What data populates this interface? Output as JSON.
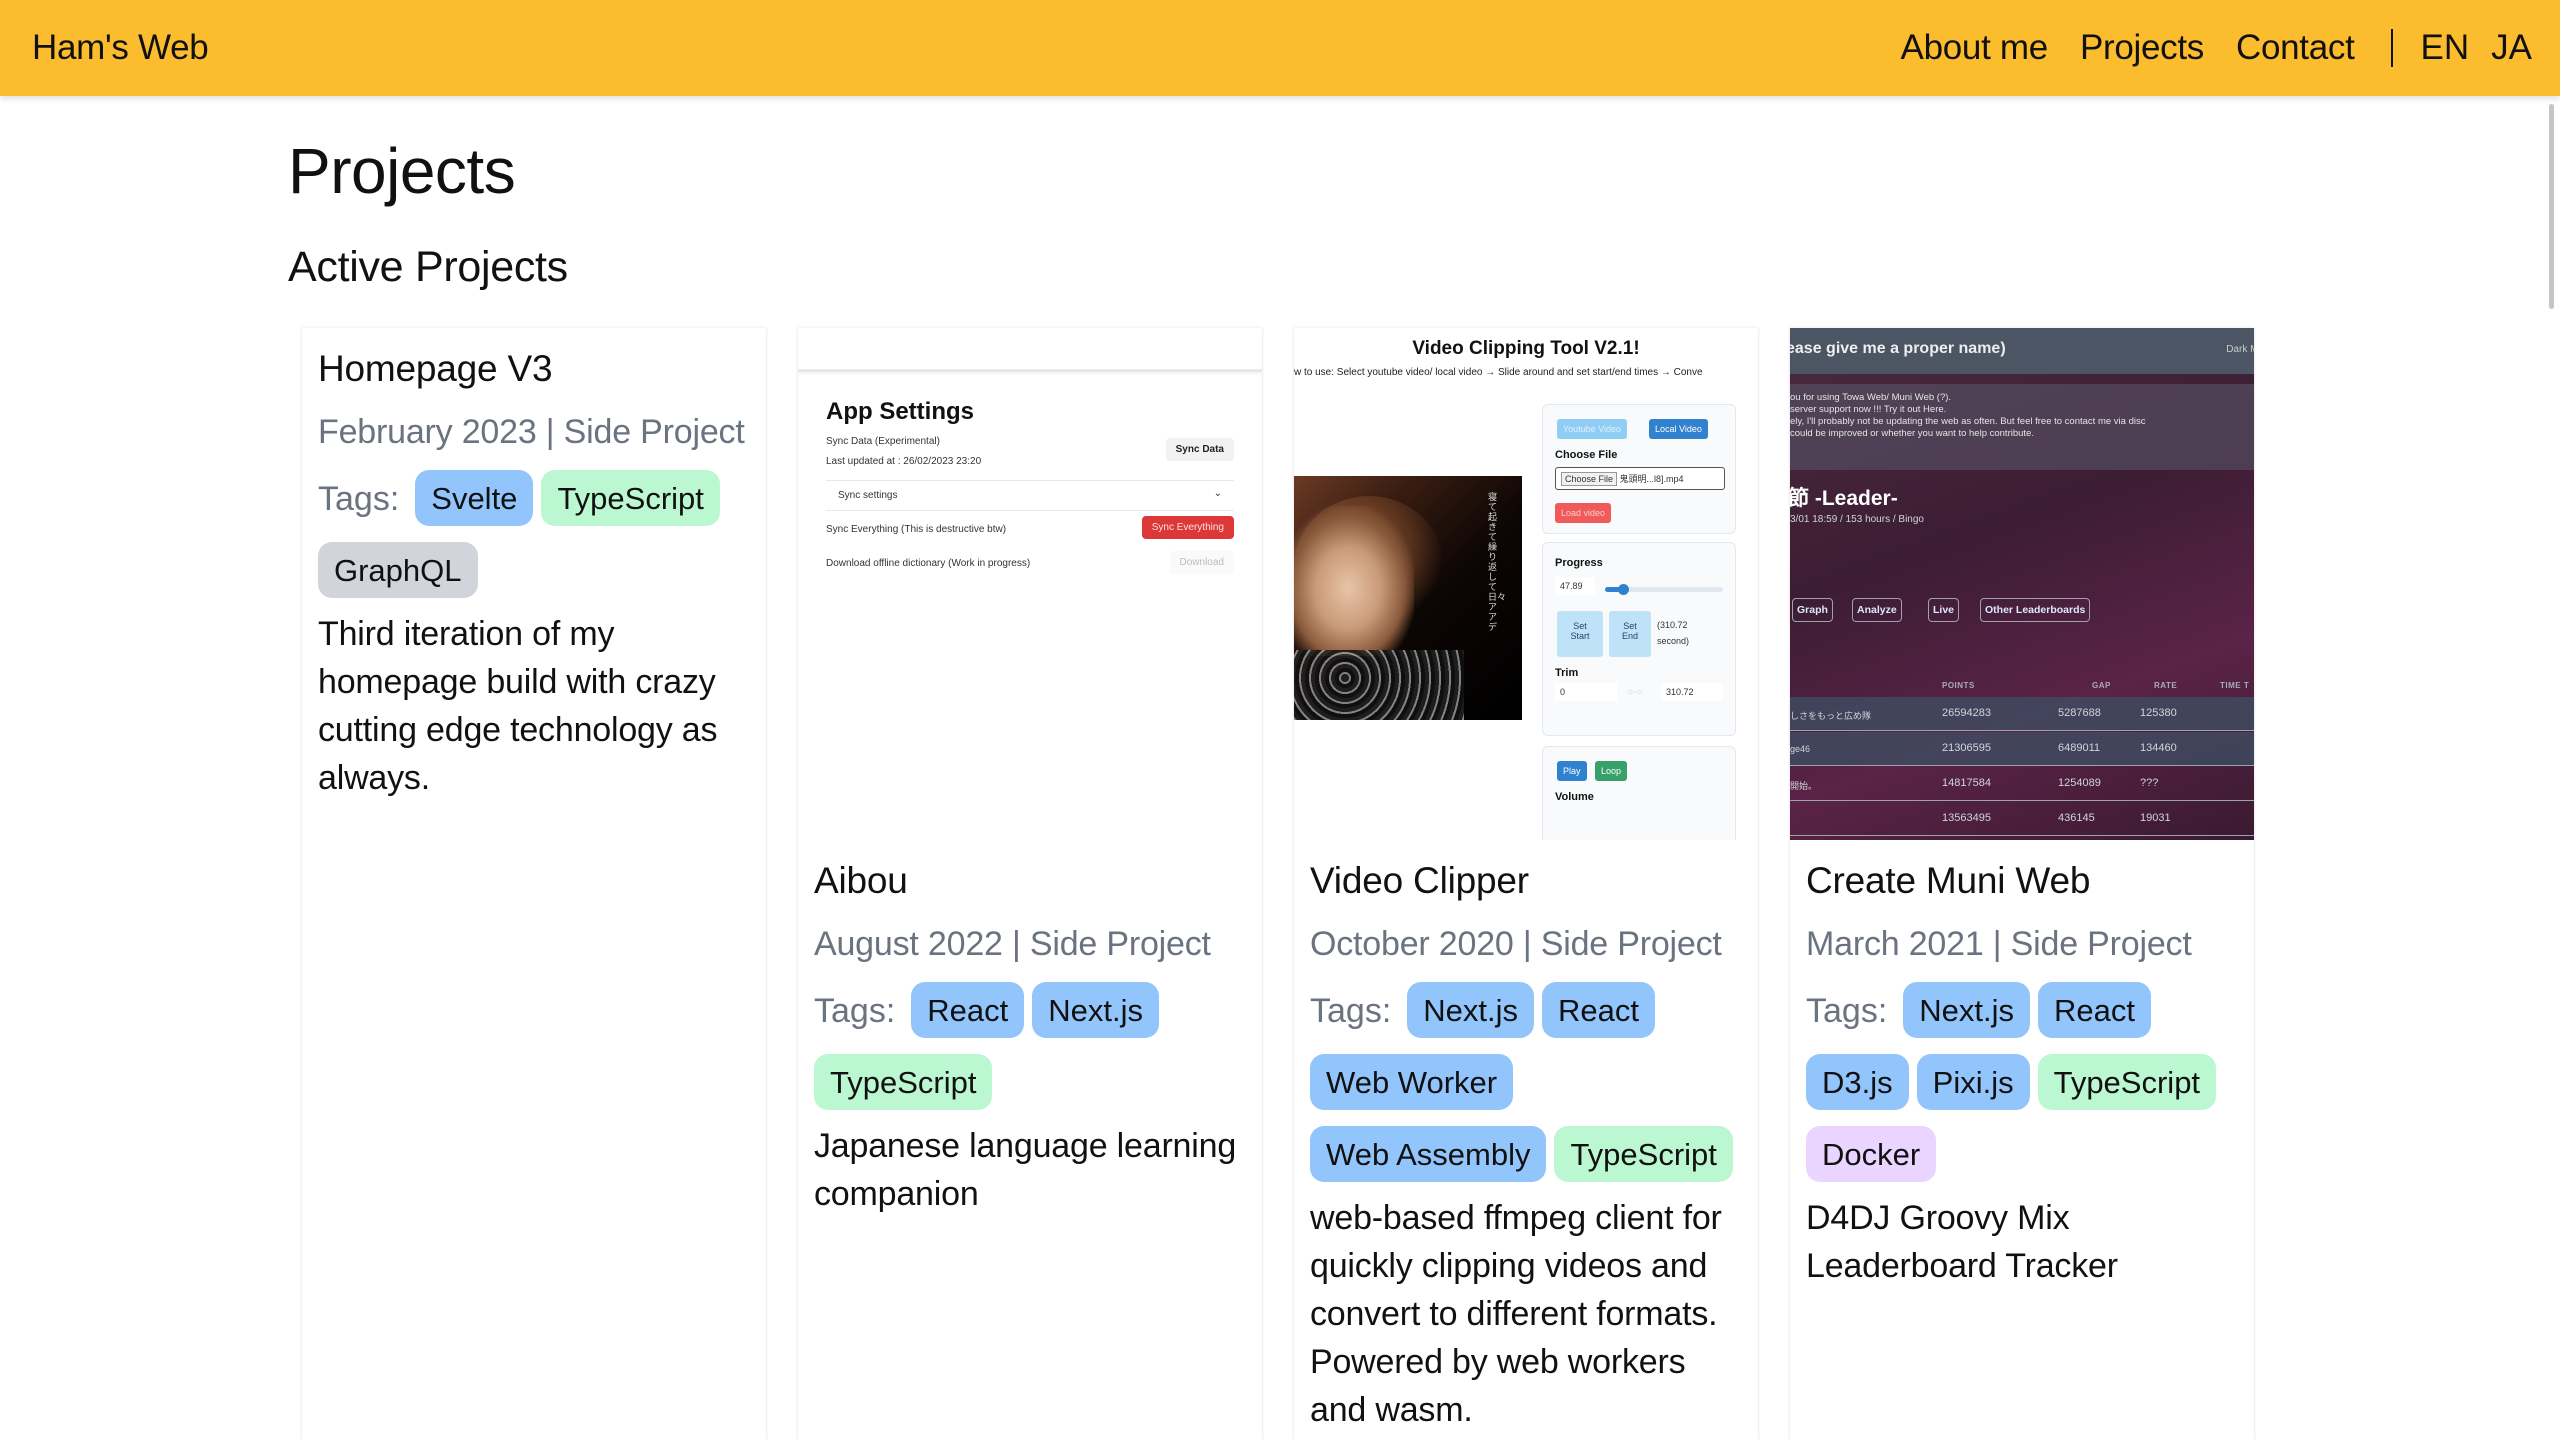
{
  "nav": {
    "brand": "Ham's Web",
    "links": [
      "About me",
      "Projects",
      "Contact"
    ],
    "languages": [
      "EN",
      "JA"
    ]
  },
  "page": {
    "title": "Projects",
    "section_title": "Active Projects"
  },
  "tag_colors": {
    "blue": "#93c5fd",
    "green": "#bbf7d0",
    "gray": "#d1d5db",
    "purple": "#e9d5ff"
  },
  "projects": [
    {
      "title": "Homepage V3",
      "meta": "February 2023 | Side Project",
      "tags_label": "Tags:",
      "tags": [
        {
          "label": "Svelte",
          "color": "blue"
        },
        {
          "label": "TypeScript",
          "color": "green"
        },
        {
          "label": "GraphQL",
          "color": "gray"
        }
      ],
      "description": "Third iteration of my homepage build with crazy cutting edge technology as always."
    },
    {
      "title": "Aibou",
      "meta": "August 2022 | Side Project",
      "tags_label": "Tags:",
      "tags": [
        {
          "label": "React",
          "color": "blue"
        },
        {
          "label": "Next.js",
          "color": "blue"
        },
        {
          "label": "TypeScript",
          "color": "green"
        }
      ],
      "description": "Japanese language learning companion",
      "screenshot": {
        "heading": "App Settings",
        "sync_label": "Sync Data (Experimental)",
        "last_updated": "Last updated at : 26/02/2023 23:20",
        "sync_button": "Sync Data",
        "sync_settings": "Sync settings",
        "sync_everything_label": "Sync Everything (This is destructive btw)",
        "sync_everything_button": "Sync Everything",
        "download_label": "Download offline dictionary (Work in progress)",
        "download_button": "Download"
      }
    },
    {
      "title": "Video Clipper",
      "meta": "October 2020 | Side Project",
      "tags_label": "Tags:",
      "tags": [
        {
          "label": "Next.js",
          "color": "blue"
        },
        {
          "label": "React",
          "color": "blue"
        },
        {
          "label": "Web Worker",
          "color": "blue"
        },
        {
          "label": "Web Assembly",
          "color": "blue"
        },
        {
          "label": "TypeScript",
          "color": "green"
        }
      ],
      "description": "web-based ffmpeg client for quickly clipping videos and convert to different formats. Powered by web workers and wasm.",
      "screenshot": {
        "heading": "Video Clipping Tool V2.1!",
        "subheading": "w to use: Select youtube video/ local video → Slide around and set start/end times → Conve",
        "youtube_button": "Youtube Video",
        "local_button": "Local Video",
        "choose_file_label": "Choose File",
        "choose_file_button": "Choose File",
        "file_name": "鬼頭明...l8].mp4",
        "load_button": "Load video",
        "progress_label": "Progress",
        "progress_value": "47.89",
        "progress_fraction": 0.154,
        "set_start": "Set Start",
        "set_end": "Set End",
        "duration": "(310.72 second)",
        "trim_label": "Trim",
        "trim_start": "0",
        "trim_end": "310.72",
        "play_button": "Play",
        "loop_button": "Loop",
        "volume_label": "Volume",
        "lyrics": "寝て起きて 繰り返して 日々アアデ"
      }
    },
    {
      "title": "Create Muni Web",
      "meta": "March 2021 | Side Project",
      "tags_label": "Tags:",
      "tags": [
        {
          "label": "Next.js",
          "color": "blue"
        },
        {
          "label": "React",
          "color": "blue"
        },
        {
          "label": "D3.js",
          "color": "blue"
        },
        {
          "label": "Pixi.js",
          "color": "blue"
        },
        {
          "label": "TypeScript",
          "color": "green"
        },
        {
          "label": "Docker",
          "color": "purple"
        }
      ],
      "description": "D4DJ Groovy Mix Leaderboard Tracker",
      "screenshot": {
        "heading": "ease give me a proper name)",
        "dark_mode": "Dark Mo",
        "notice": [
          "ou for using Towa Web/ Muni Web (?).",
          "server support now !!! Try it out Here.",
          "ely, I'll probably not be updating the web as often. But feel free to contact me via disc",
          "could be improved or whether you want to help contribute."
        ],
        "event_title": "節 -Leader-",
        "event_sub": "3/01 18:59 / 153 hours / Bingo",
        "buttons": [
          "Graph",
          "Analyze",
          "Live",
          "Other Leaderboards"
        ],
        "columns": [
          "POINTS",
          "GAP",
          "RATE",
          "TIME T"
        ],
        "rows": [
          {
            "name": "しさをもっと広め隊",
            "points": "26594283",
            "gap": "5287688",
            "rate": "125380"
          },
          {
            "name": "ge46",
            "points": "21306595",
            "gap": "6489011",
            "rate": "134460"
          },
          {
            "name": "開始。",
            "points": "14817584",
            "gap": "1254089",
            "rate": "???"
          },
          {
            "name": "",
            "points": "13563495",
            "gap": "436145",
            "rate": "19031"
          }
        ]
      }
    }
  ]
}
